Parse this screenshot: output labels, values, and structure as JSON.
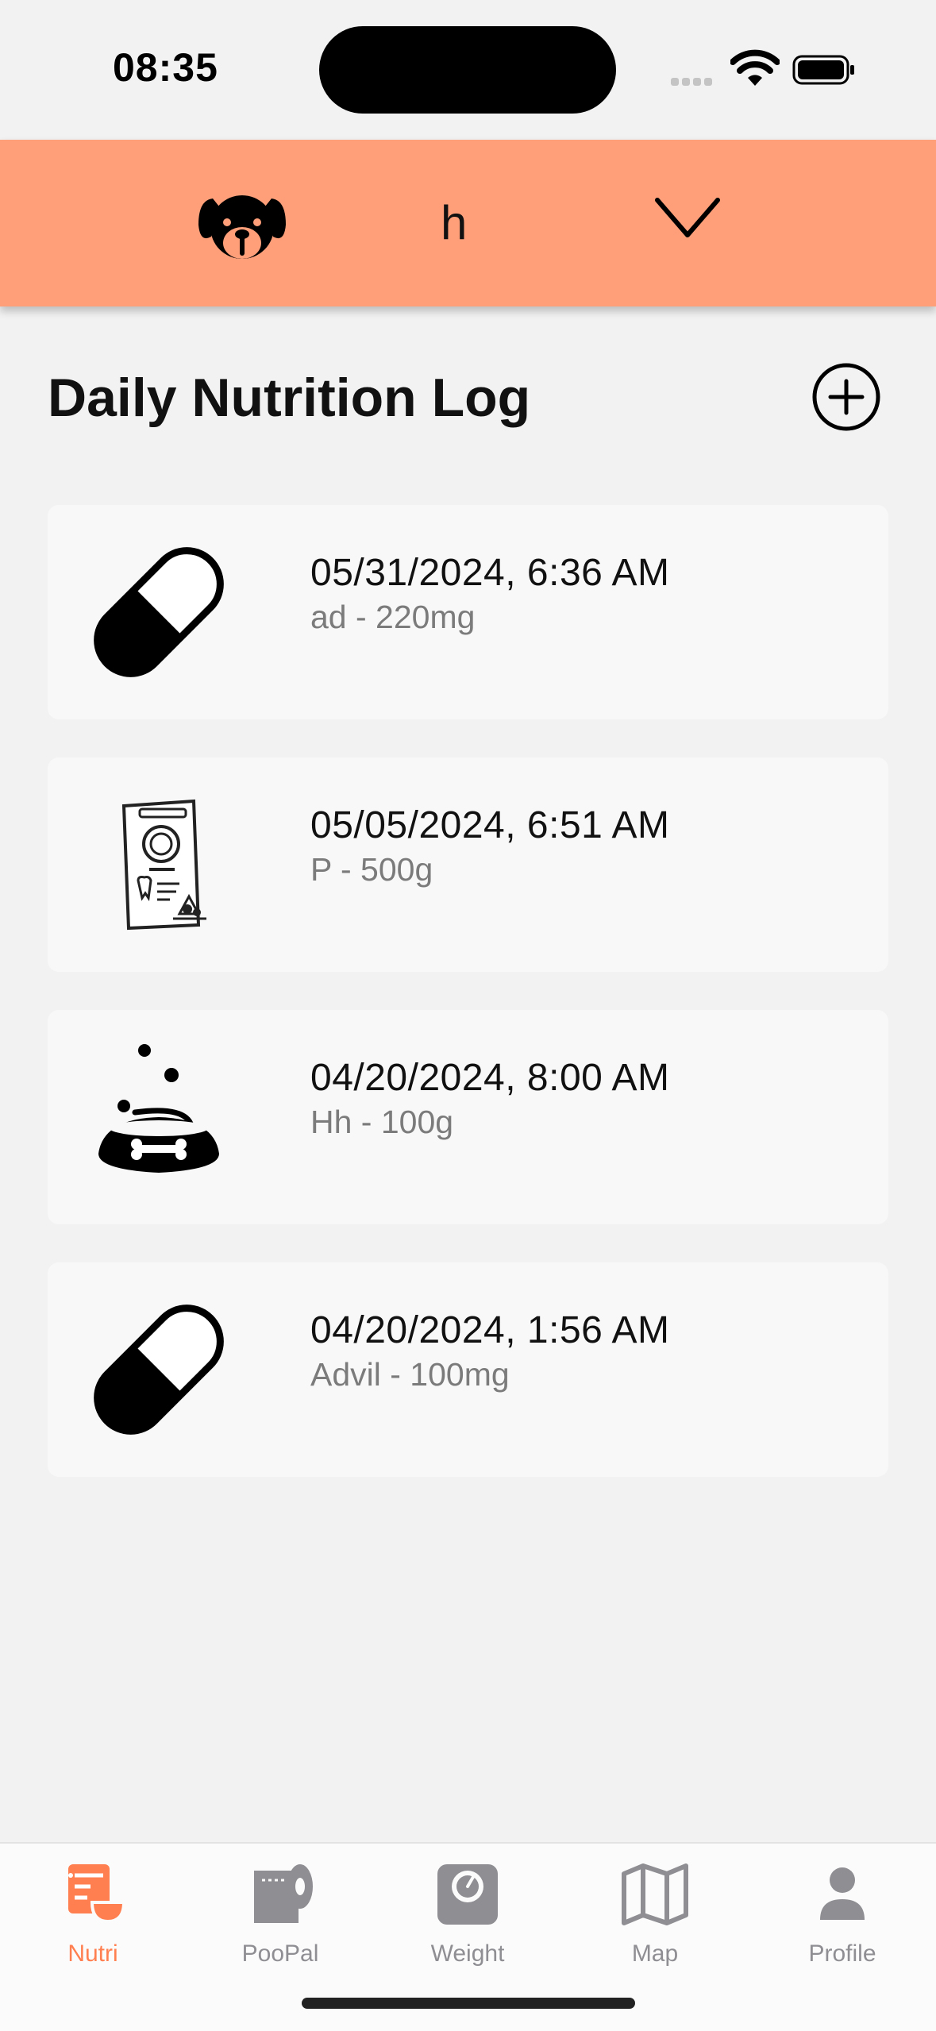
{
  "status_bar": {
    "time": "08:35"
  },
  "pet_selector": {
    "name": "h"
  },
  "page": {
    "title": "Daily Nutrition Log"
  },
  "logs": [
    {
      "date": "05/31/2024, 6:36 AM",
      "detail": "ad - 220mg",
      "icon": "pill-icon"
    },
    {
      "date": "05/05/2024, 6:51 AM",
      "detail": "P - 500g",
      "icon": "food-bag-icon"
    },
    {
      "date": "04/20/2024, 8:00 AM",
      "detail": "Hh - 100g",
      "icon": "dog-bowl-icon"
    },
    {
      "date": "04/20/2024, 1:56 AM",
      "detail": "Advil - 100mg",
      "icon": "pill-icon"
    }
  ],
  "tabs": [
    {
      "label": "Nutri",
      "icon": "nutri-icon",
      "active": true
    },
    {
      "label": "PooPal",
      "icon": "toilet-roll-icon",
      "active": false
    },
    {
      "label": "Weight",
      "icon": "scale-icon",
      "active": false
    },
    {
      "label": "Map",
      "icon": "map-icon",
      "active": false
    },
    {
      "label": "Profile",
      "icon": "person-icon",
      "active": false
    }
  ],
  "colors": {
    "accent": "#ff7f50",
    "header": "#ff9f7a",
    "inactive": "#8e8e93"
  }
}
